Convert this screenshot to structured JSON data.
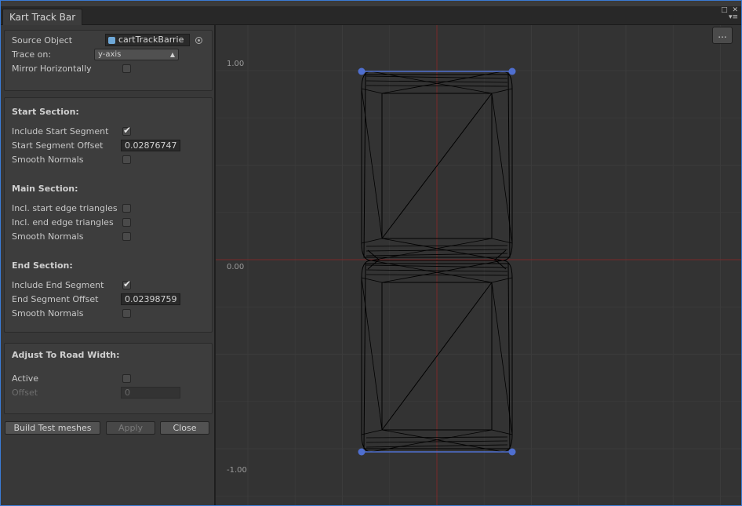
{
  "window": {
    "tab_title": "Kart Track Bar",
    "icons": [
      "maximize-icon",
      "close-icon",
      "menu-icon"
    ]
  },
  "source": {
    "label": "Source Object",
    "value": "cartTrackBarrie",
    "icon": "mesh-icon",
    "picker_icon": "object-picker-icon",
    "trace_label": "Trace on:",
    "trace_value": "y-axis",
    "mirror_label": "Mirror Horizontally",
    "mirror_checked": false
  },
  "start_section": {
    "header": "Start Section:",
    "include_label": "Include Start Segment",
    "include_checked": true,
    "offset_label": "Start Segment Offset",
    "offset_value": "0.02876747",
    "smooth_label": "Smooth Normals",
    "smooth_checked": false
  },
  "main_section": {
    "header": "Main Section:",
    "start_edge_label": "Incl. start edge triangles",
    "start_edge_checked": false,
    "end_edge_label": "Incl. end edge triangles",
    "end_edge_checked": false,
    "smooth_label": "Smooth Normals",
    "smooth_checked": false
  },
  "end_section": {
    "header": "End Section:",
    "include_label": "Include End Segment",
    "include_checked": true,
    "offset_label": "End Segment Offset",
    "offset_value": "0.02398759",
    "smooth_label": "Smooth Normals",
    "smooth_checked": false
  },
  "adjust": {
    "header": "Adjust To Road Width:",
    "active_label": "Active",
    "active_checked": false,
    "offset_label": "Offset",
    "offset_value": "0"
  },
  "buttons": {
    "build": "Build Test meshes",
    "apply": "Apply",
    "close": "Close"
  },
  "preview": {
    "more_label": "...",
    "axis_top": "1.00",
    "axis_mid": "0.00",
    "axis_bottom": "-1.00",
    "colors": {
      "background": "#333333",
      "grid": "#3b3b3b",
      "axis": "#7a2a2a",
      "mesh": "#000000",
      "handle": "#4f6fd0"
    }
  }
}
